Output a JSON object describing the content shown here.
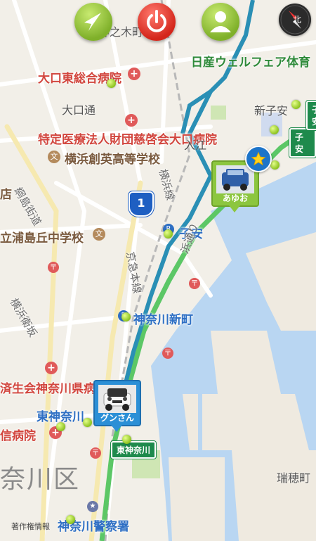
{
  "toolbar": {
    "navigate_button": "navigate-arrow",
    "power_button": "power",
    "profile_button": "person"
  },
  "compass": {
    "label": "北"
  },
  "places": {
    "kannoki": "神之木町",
    "nissan": "日産ウェルフェア体育",
    "ohguchi_hospital": "大口東総合病院",
    "ohguchi_dori": "大口通",
    "jikeikai": "特定医療法人財団慈啓会大口病院",
    "yokohama_soei": "横浜創英高等学校",
    "iriechi": "入江",
    "koyasu_station": "新子安",
    "koyasu_badge": "子安",
    "koyasu_badge2": "子安",
    "tsunashima": "綱島街道",
    "route1": "1",
    "tachiura": "立浦島丘中学校",
    "ten": "店",
    "koyasu": "子安",
    "yokohama_line": "横浜線",
    "keikyu": "京急本線",
    "hama_dori": "浜通り",
    "kanagawa_shin": "神奈川新町",
    "yokohama_wharf": "横浜衛坂",
    "saiseikai": "済生会神奈川県病",
    "higashi_kanagawa": "東神奈川",
    "shin_hospital": "信病院",
    "higashi_kanagawa_badge": "東神奈川",
    "kanagawa_ku": "奈川区",
    "mizuho": "瑞穂町",
    "police": "神奈川警察署",
    "copyright": "著作権情報"
  },
  "markers": {
    "ayuo": "あゆお",
    "gun": "グンさん"
  },
  "colors": {
    "route_blue": "#2a8fb5",
    "route_green": "#5cc766",
    "water": "#b9d6f2",
    "pin_green": "#8cc63f",
    "pin_blue": "#2b8fd6"
  }
}
